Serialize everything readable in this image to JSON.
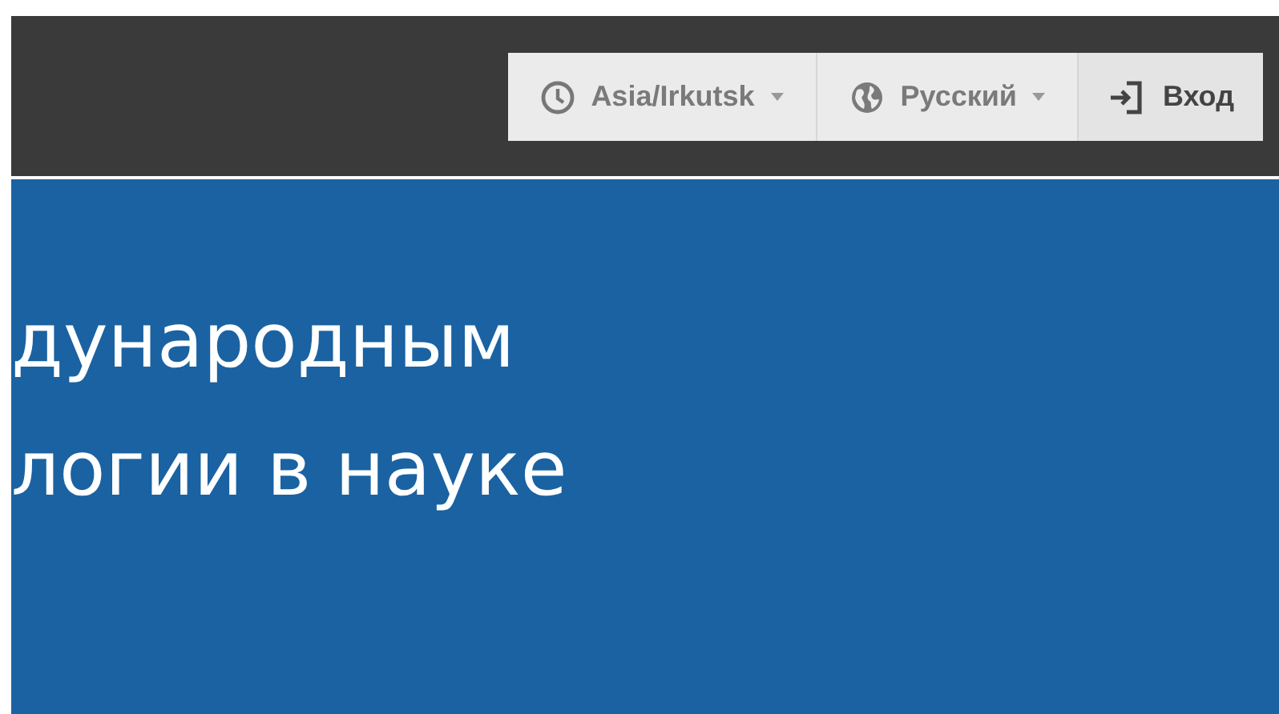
{
  "toolbar": {
    "items": [
      {
        "kind": "timezone",
        "label": "Asia/Irkutsk",
        "dropdown": true
      },
      {
        "kind": "language",
        "label": "Русский",
        "dropdown": true
      },
      {
        "kind": "login",
        "label": "Вход",
        "dropdown": false
      }
    ]
  },
  "hero": {
    "lines": [
      "дународным",
      "логии в науке"
    ]
  }
}
